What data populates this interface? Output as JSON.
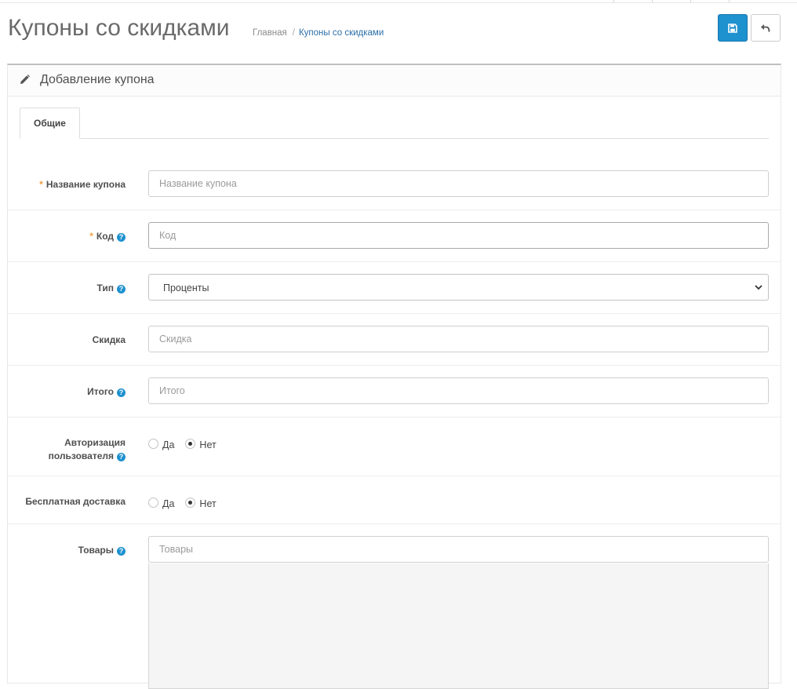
{
  "header": {
    "title": "Купоны со скидками",
    "breadcrumb": {
      "home": "Главная",
      "separator": "/",
      "current": "Купоны со скидками"
    },
    "buttons": {
      "save_icon": "save-icon",
      "back_icon": "reply-icon"
    }
  },
  "panel": {
    "title": "Добавление купона",
    "icon": "pencil-icon"
  },
  "tabs": [
    {
      "label": "Общие",
      "active": true
    }
  ],
  "form": {
    "required_mark": "*",
    "help_glyph": "?",
    "coupon_name": {
      "label": "Название купона",
      "placeholder": "Название купона",
      "value": ""
    },
    "code": {
      "label": "Код",
      "placeholder": "Код",
      "value": ""
    },
    "type": {
      "label": "Тип",
      "selected": "Проценты"
    },
    "discount": {
      "label": "Скидка",
      "placeholder": "Скидка",
      "value": ""
    },
    "total": {
      "label": "Итого",
      "placeholder": "Итого",
      "value": ""
    },
    "customer_login": {
      "label_line1": "Авторизация",
      "label_line2": "пользователя",
      "yes": "Да",
      "no": "Нет",
      "selected": "Нет"
    },
    "free_shipping": {
      "label": "Бесплатная доставка",
      "yes": "Да",
      "no": "Нет",
      "selected": "Нет"
    },
    "products": {
      "label": "Товары",
      "placeholder": "Товары",
      "value": ""
    }
  },
  "colors": {
    "primary": "#1e91cf",
    "required": "#f0a03c",
    "link": "#2b6ea8"
  }
}
